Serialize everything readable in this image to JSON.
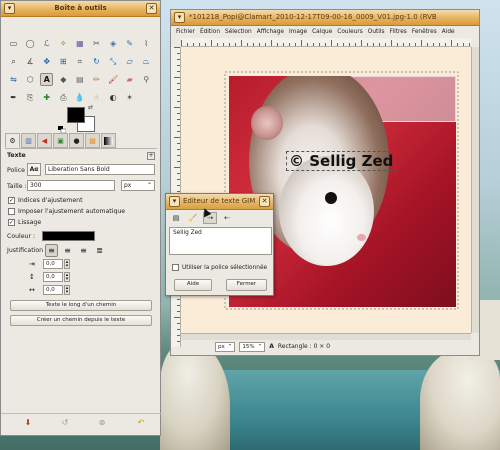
{
  "toolbox": {
    "title": "Boîte à outils",
    "tools": [
      {
        "icon": "rect-select-icon",
        "g": "▭",
        "c": "#444"
      },
      {
        "icon": "ellipse-select-icon",
        "g": "◯",
        "c": "#444"
      },
      {
        "icon": "lasso-icon",
        "g": "ℒ",
        "c": "#555"
      },
      {
        "icon": "fuzzy-select-icon",
        "g": "✧",
        "c": "#8b6b12"
      },
      {
        "icon": "color-select-icon",
        "g": "▦",
        "c": "#5a5aa0"
      },
      {
        "icon": "scissors-icon",
        "g": "✂",
        "c": "#555"
      },
      {
        "icon": "foreground-select-icon",
        "g": "◈",
        "c": "#3b6fb6"
      },
      {
        "icon": "paths-icon",
        "g": "✎",
        "c": "#3b6fb6"
      },
      {
        "icon": "color-picker-icon",
        "g": "⌇",
        "c": "#555"
      },
      {
        "icon": "zoom-icon",
        "g": "⌕",
        "c": "#333"
      },
      {
        "icon": "measure-icon",
        "g": "∡",
        "c": "#555"
      },
      {
        "icon": "move-icon",
        "g": "✥",
        "c": "#1f5fb0"
      },
      {
        "icon": "align-icon",
        "g": "⊞",
        "c": "#1f5fb0"
      },
      {
        "icon": "crop-icon",
        "g": "⌗",
        "c": "#555"
      },
      {
        "icon": "rotate-icon",
        "g": "↻",
        "c": "#1f5fb0"
      },
      {
        "icon": "scale-icon",
        "g": "⤡",
        "c": "#1f5fb0"
      },
      {
        "icon": "shear-icon",
        "g": "▱",
        "c": "#1f5fb0"
      },
      {
        "icon": "perspective-icon",
        "g": "⏢",
        "c": "#1f5fb0"
      },
      {
        "icon": "flip-icon",
        "g": "⇋",
        "c": "#1f5fb0"
      },
      {
        "icon": "cage-icon",
        "g": "⬡",
        "c": "#555"
      },
      {
        "icon": "text-icon",
        "g": "A",
        "c": "#111"
      },
      {
        "icon": "bucket-fill-icon",
        "g": "◆",
        "c": "#555"
      },
      {
        "icon": "blend-icon",
        "g": "▤",
        "c": "#666"
      },
      {
        "icon": "pencil-icon",
        "g": "✏",
        "c": "#b07b1f"
      },
      {
        "icon": "paintbrush-icon",
        "g": "🖌",
        "c": "#b0391f"
      },
      {
        "icon": "eraser-icon",
        "g": "▰",
        "c": "#d06a7a"
      },
      {
        "icon": "airbrush-icon",
        "g": "⚲",
        "c": "#555"
      },
      {
        "icon": "ink-icon",
        "g": "✒",
        "c": "#222"
      },
      {
        "icon": "clone-icon",
        "g": "⎘",
        "c": "#555"
      },
      {
        "icon": "heal-icon",
        "g": "✚",
        "c": "#2a8a2a"
      },
      {
        "icon": "perspective-clone-icon",
        "g": "⎙",
        "c": "#555"
      },
      {
        "icon": "blur-icon",
        "g": "💧",
        "c": "#2a7fc0"
      },
      {
        "icon": "smudge-icon",
        "g": "☝",
        "c": "#c08a50"
      },
      {
        "icon": "dodge-icon",
        "g": "◐",
        "c": "#333"
      },
      {
        "icon": "star-icon",
        "g": "✶",
        "c": "#555"
      }
    ]
  },
  "tool_options": {
    "section": "Texte",
    "font_label": "Police :",
    "font_icon": "Aα",
    "font_value": "Liberation Sans Bold",
    "size_label": "Taille :",
    "size_value": "300",
    "unit_value": "px",
    "hinting": "Indices d'ajustement",
    "force_hinting": "Imposer l'ajustement automatique",
    "antialias": "Lissage",
    "color_label": "Couleur :",
    "justify_label": "Justification :",
    "indent_value": "0,0",
    "line_spacing_value": "0,0",
    "letter_spacing_value": "0,0",
    "path_button": "Texte le long d'un chemin",
    "create_path_button": "Créer un chemin depuis le texte"
  },
  "image_window": {
    "title": "*101218_Popi@Clamart_2010-12-17T09-00-16_0009_V01.jpg-1.0 (RVB",
    "menus": [
      "Fichier",
      "Édition",
      "Sélection",
      "Affichage",
      "Image",
      "Calque",
      "Couleurs",
      "Outils",
      "Filtres",
      "Fenêtres",
      "Aide"
    ],
    "canvas_text": "© Sellig Zed",
    "unit": "px",
    "zoom": "15%",
    "status": "Rectangle : 0 × 0"
  },
  "text_editor": {
    "title": "Éditeur de texte GIM",
    "content": "Sellig Zed",
    "use_font_label": "Utiliser la police sélectionnée",
    "help_button": "Aide",
    "close_button": "Fermer"
  }
}
